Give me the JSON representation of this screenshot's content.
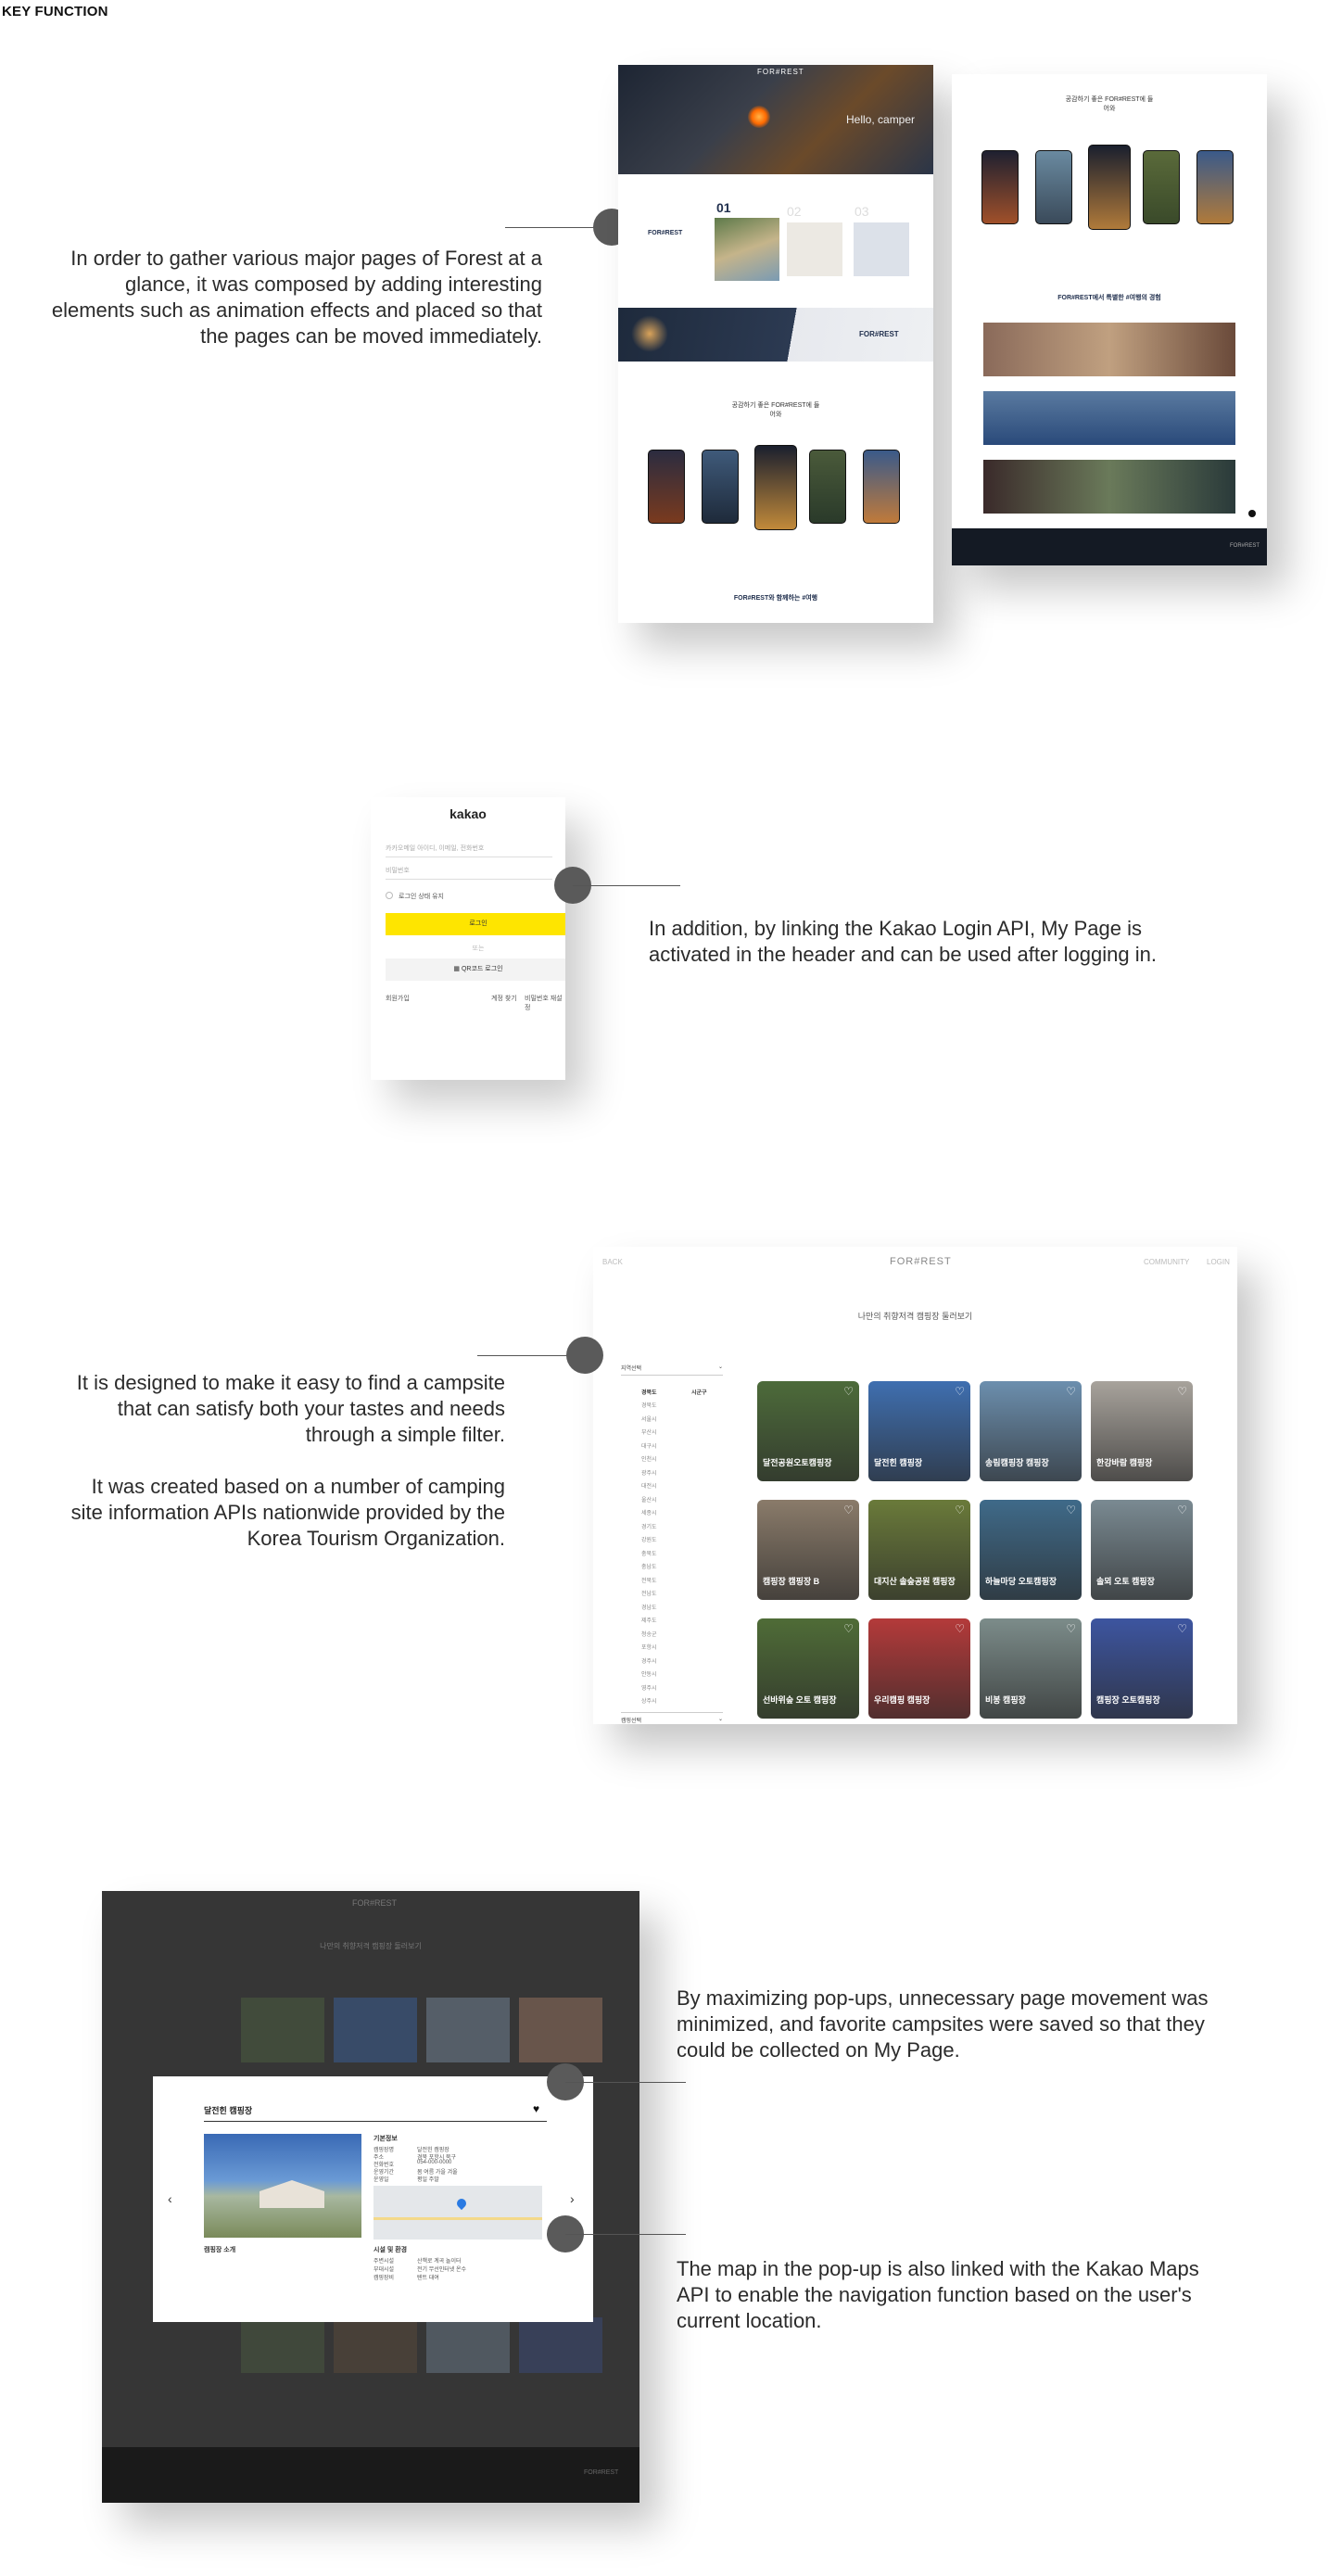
{
  "page": {
    "heading": "KEY FUNCTION"
  },
  "section1": {
    "description": "In order to gather various major pages of Forest at a glance, it was composed by adding interesting elements such as animation effects and placed so that the pages can be moved immediately.",
    "main_page": {
      "logo": "FOR#REST",
      "hero_text": "Hello, camper",
      "slider_numbers": [
        "01",
        "02",
        "03"
      ],
      "brand": "FOR#REST",
      "community_title": "공감하기 좋은 FOR#REST에 들어와",
      "footer_title": "FOR#REST와 함께하는 #여행"
    },
    "sub_page": {
      "community_title": "공감하기 좋은 FOR#REST에 들어와",
      "story_title": "FOR#REST에서 특별한 #여행의 경험"
    }
  },
  "section2": {
    "description": "In addition, by linking the Kakao Login API, My Page is activated in the header and can be used after logging in.",
    "login": {
      "logo": "kakao",
      "email_placeholder": "카카오메일 아이디, 이메일, 전화번호",
      "password_placeholder": "비밀번호",
      "keep_login": "로그인 상태 유지",
      "login_button": "로그인",
      "or": "또는",
      "qr_button": "QR코드 로그인",
      "signup": "회원가입",
      "find": "계정 찾기",
      "reset": "비밀번호 재설정"
    }
  },
  "section3": {
    "description_1": "It is designed to make it easy to find a campsite that can satisfy both your tastes and needs through a simple filter.",
    "description_2": "It was created based on a number of camping site information APIs nationwide provided by the Korea Tourism Organization.",
    "list_page": {
      "back": "BACK",
      "logo": "FOR#REST",
      "community": "COMMUNITY",
      "login": "LOGIN",
      "title": "나만의 취향저격 캠핑장 둘러보기",
      "filter_label": "지역선택",
      "filter_col1": "경북도",
      "filter_col2": "시군구",
      "filter_bottom": "캠핑선택",
      "regions": [
        "경북도",
        "서울시",
        "부산시",
        "대구시",
        "인천시",
        "광주시",
        "대전시",
        "울산시",
        "세종시",
        "경기도",
        "강원도",
        "충북도",
        "충남도",
        "전북도",
        "전남도",
        "경남도",
        "제주도",
        "청송군",
        "포항시",
        "경주시",
        "안동시",
        "영주시",
        "상주시"
      ],
      "campsites": [
        {
          "name": "달전공원오토캠핑장",
          "color": "#4d6b3a"
        },
        {
          "name": "달전힌 캠핑장",
          "color": "#3f6fb0"
        },
        {
          "name": "송림캠핑장 캠핑장",
          "color": "#6c8fae"
        },
        {
          "name": "한강바람 캠핑장",
          "color": "#a8a39c"
        },
        {
          "name": "캠핑장 캠핑장 B",
          "color": "#8a7b6a"
        },
        {
          "name": "대지산 솔숲공원 캠핑장",
          "color": "#6a7a3a"
        },
        {
          "name": "하늘마당 오토캠핑장",
          "color": "#3f6a89"
        },
        {
          "name": "솔뫼 오토 캠핑장",
          "color": "#7a8a92"
        },
        {
          "name": "선바위숲 오토 캠핑장",
          "color": "#4f6c37"
        },
        {
          "name": "우리캠핑 캠핑장",
          "color": "#b43a3a"
        },
        {
          "name": "비봉 캠핑장",
          "color": "#7c8c8a"
        },
        {
          "name": "캠핑장 오토캠핑장",
          "color": "#3d55a0"
        }
      ]
    }
  },
  "section4": {
    "description_1": "By maximizing pop-ups, unnecessary page movement was minimized, and favorite campsites were saved so that they could be collected on My Page.",
    "description_2": "The map in the pop-up is also linked with the Kakao Maps API to enable the navigation function based on the user's current location.",
    "popup": {
      "logo": "FOR#REST",
      "bg_title": "나만의 취향저격 캠핑장 둘러보기",
      "title": "달전힌 캠핑장",
      "info_header": "기본정보",
      "info_rows": [
        {
          "key": "캠핑장명",
          "value": "달전힌 캠핑장"
        },
        {
          "key": "주소",
          "value": "경북 포항시 북구"
        },
        {
          "key": "전화번호",
          "value": "054-000-0000"
        },
        {
          "key": "운영기간",
          "value": "봄 여름 가을 겨울"
        },
        {
          "key": "운영일",
          "value": "평일 주말"
        }
      ],
      "facility_header": "시설 및 환경",
      "facility_rows": [
        {
          "key": "주변시설",
          "value": "산책로 계곡 놀이터"
        },
        {
          "key": "부대시설",
          "value": "전기 무선인터넷 온수"
        },
        {
          "key": "캠핑장비",
          "value": "텐트 대여"
        }
      ],
      "desc_header": "캠핑장 소개",
      "prev": "‹",
      "next": "›",
      "heart": "♥",
      "footer_logo": "FOR#REST"
    }
  }
}
